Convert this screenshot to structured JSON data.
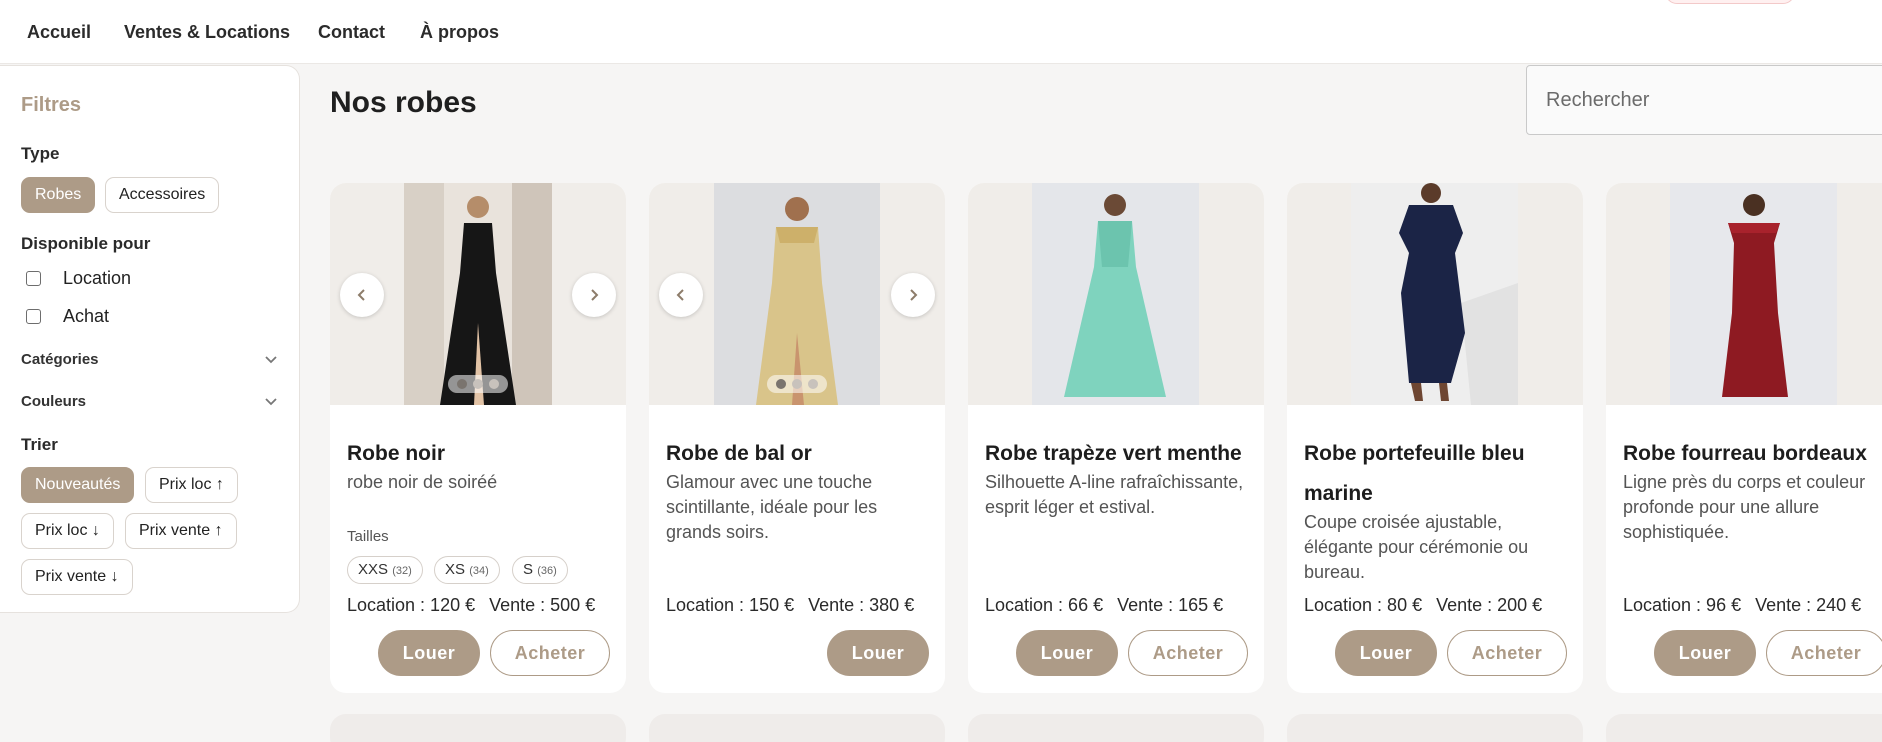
{
  "nav": {
    "links": [
      "Accueil",
      "Ventes & Locations",
      "Contact",
      "À propos"
    ]
  },
  "filters": {
    "title": "Filtres",
    "type_label": "Type",
    "type_options": [
      "Robes",
      "Accessoires"
    ],
    "type_selected": "Robes",
    "availability_label": "Disponible pour",
    "availability_options": [
      "Location",
      "Achat"
    ],
    "categories_label": "Catégories",
    "colors_label": "Couleurs",
    "sort_label": "Trier",
    "sort_options": [
      "Nouveautés",
      "Prix loc ↑",
      "Prix loc ↓",
      "Prix vente ↑",
      "Prix vente ↓"
    ],
    "sort_selected": "Nouveautés"
  },
  "main": {
    "title": "Nos robes",
    "search_placeholder": "Rechercher"
  },
  "products": [
    {
      "name": "Robe noir",
      "description": "robe noir de soiréé",
      "sizes_label": "Tailles",
      "sizes": [
        {
          "label": "XXS",
          "num": "(32)"
        },
        {
          "label": "XS",
          "num": "(34)"
        },
        {
          "label": "S",
          "num": "(36)"
        }
      ],
      "rent": "Location : 120 €",
      "sale": "Vente : 500 €",
      "rent_btn": "Louer",
      "buy_btn": "Acheter",
      "dress_color": "#161616"
    },
    {
      "name": "Robe de bal or",
      "description": "Glamour avec une touche scintillante, idéale pour les grands soirs.",
      "rent": "Location : 150 €",
      "sale": "Vente : 380 €",
      "rent_btn": "Louer",
      "dress_color": "#d9c48a"
    },
    {
      "name": "Robe trapèze vert menthe",
      "description": "Silhouette A-line rafraîchissante, esprit léger et estival.",
      "rent": "Location : 66 €",
      "sale": "Vente : 165 €",
      "rent_btn": "Louer",
      "buy_btn": "Acheter",
      "dress_color": "#7fd3be"
    },
    {
      "name": "Robe portefeuille bleu marine",
      "description": "Coupe croisée ajustable, élégante pour cérémonie ou bureau.",
      "rent": "Location : 80 €",
      "sale": "Vente : 200 €",
      "rent_btn": "Louer",
      "buy_btn": "Acheter",
      "dress_color": "#1b2446"
    },
    {
      "name": "Robe fourreau bordeaux",
      "description": "Ligne près du corps et couleur profonde pour une allure sophistiquée.",
      "rent": "Location : 96 €",
      "sale": "Vente : 240 €",
      "rent_btn": "Louer",
      "buy_btn": "Acheter",
      "dress_color": "#8e1a22"
    }
  ],
  "colors": {
    "accent": "#ad9b87"
  }
}
